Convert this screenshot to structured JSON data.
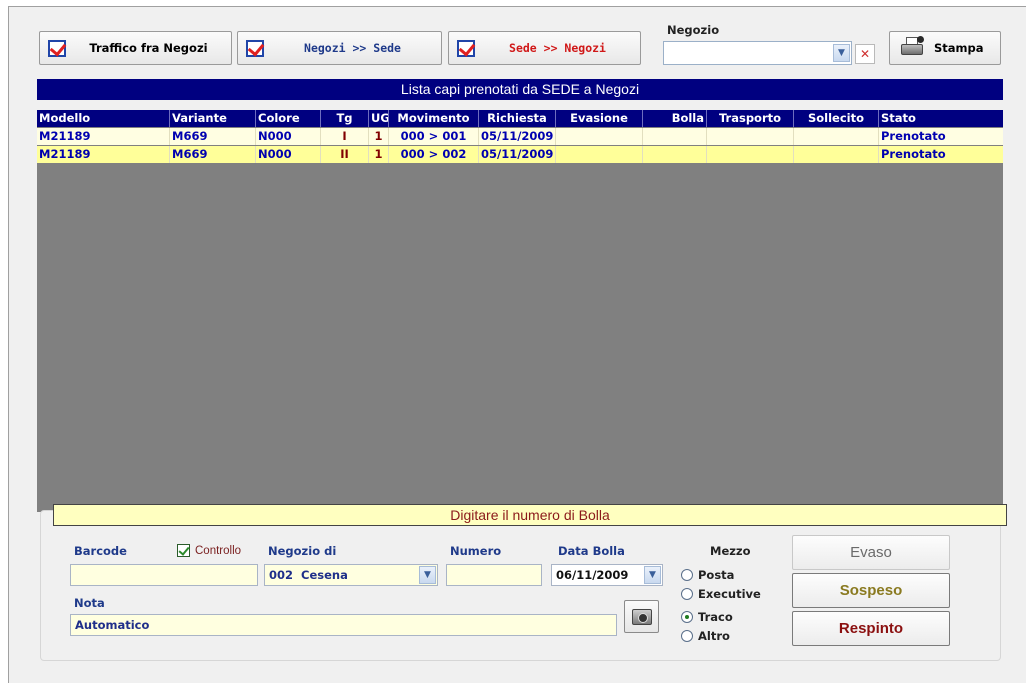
{
  "toolbar": {
    "traffic_label": "Traffico fra Negozi",
    "to_hq_label": "Negozi >> Sede",
    "from_hq_label": "Sede >> Negozi",
    "store_label": "Negozio",
    "store_value": "",
    "print_label": "Stampa"
  },
  "list": {
    "title": "Lista capi prenotati da SEDE a Negozi",
    "columns": [
      "Modello",
      "Variante",
      "Colore",
      "Tg",
      "UG",
      "Movimento",
      "Richiesta",
      "Evasione",
      "Bolla",
      "Trasporto",
      "Sollecito",
      "Stato"
    ],
    "rows": [
      {
        "modello": "M21189",
        "variante": "M669",
        "colore": "N000",
        "tg": "I",
        "ug": "1",
        "movimento": "000 > 001",
        "richiesta": "05/11/2009",
        "evasione": "",
        "bolla": "",
        "trasporto": "",
        "sollecito": "",
        "stato": "Prenotato"
      },
      {
        "modello": "M21189",
        "variante": "M669",
        "colore": "N000",
        "tg": "II",
        "ug": "1",
        "movimento": "000 > 002",
        "richiesta": "05/11/2009",
        "evasione": "",
        "bolla": "",
        "trasporto": "",
        "sollecito": "",
        "stato": "Prenotato"
      }
    ]
  },
  "form": {
    "prompt": "Digitare il numero di Bolla",
    "barcode_label": "Barcode",
    "barcode_value": "",
    "controllo_label": "Controllo",
    "negozio_di_label": "Negozio di",
    "negozio_di_value": "002  Cesena",
    "numero_label": "Numero",
    "numero_value": "",
    "data_bolla_label": "Data Bolla",
    "data_bolla_value": "06/11/2009",
    "nota_label": "Nota",
    "nota_value": "Automatico",
    "mezzo_label": "Mezzo",
    "mezzo_options": [
      "Posta",
      "Executive",
      "Traco",
      "Altro"
    ],
    "mezzo_selected": "Traco"
  },
  "actions": {
    "evaso": "Evaso",
    "sospeso": "Sospeso",
    "respinto": "Respinto"
  }
}
